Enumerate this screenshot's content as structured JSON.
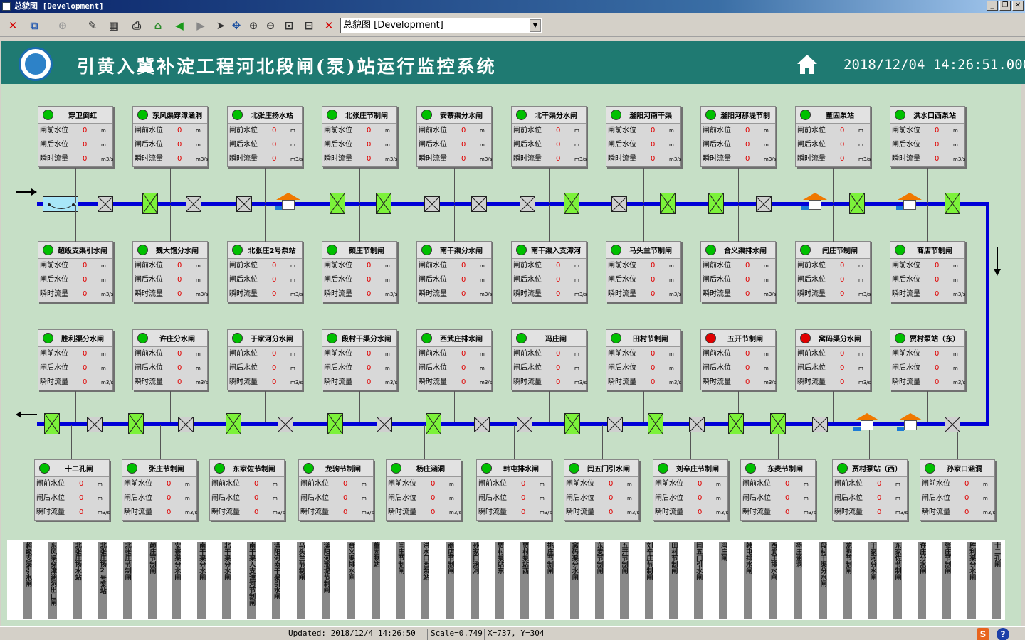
{
  "window": {
    "title": "总貌图 [Development]"
  },
  "toolbar": {
    "view_select": "总貌图 [Development]"
  },
  "header": {
    "title": "引黄入冀补淀工程河北段闸(泵)站运行监控系统",
    "datetime": "2018/12/04 14:26:51.000"
  },
  "row_labels": {
    "front_level": "闸前水位",
    "back_level": "闸后水位",
    "flow": "瞬时流量",
    "unit_level": "m",
    "unit_flow": "m3/s"
  },
  "stations": [
    {
      "name": "穿卫倒虹",
      "status": "green",
      "values": [
        "0",
        "0",
        "0"
      ]
    },
    {
      "name": "东风渠穿漳涵洞",
      "status": "green",
      "values": [
        "0",
        "0",
        "0"
      ]
    },
    {
      "name": "北张庄扬水站",
      "status": "green",
      "values": [
        "0",
        "0",
        "0"
      ]
    },
    {
      "name": "北张庄节制闸",
      "status": "green",
      "values": [
        "0",
        "0",
        "0"
      ]
    },
    {
      "name": "安寨渠分水闸",
      "status": "green",
      "values": [
        "0",
        "0",
        "0"
      ]
    },
    {
      "name": "北干渠分水闸",
      "status": "green",
      "values": [
        "0",
        "0",
        "0"
      ]
    },
    {
      "name": "滏阳河南干渠",
      "status": "green",
      "values": [
        "0",
        "0",
        "0"
      ]
    },
    {
      "name": "滏阳河那堤节制",
      "status": "green",
      "values": [
        "0",
        "0",
        "0"
      ]
    },
    {
      "name": "董固泵站",
      "status": "green",
      "values": [
        "0",
        "0",
        "0"
      ]
    },
    {
      "name": "洪水口西泵站",
      "status": "green",
      "values": [
        "0",
        "0",
        "0"
      ]
    },
    {
      "name": "超级支渠引水闸",
      "status": "green",
      "values": [
        "0",
        "0",
        "0"
      ]
    },
    {
      "name": "魏大馆分水闸",
      "status": "green",
      "values": [
        "0",
        "0",
        "0"
      ]
    },
    {
      "name": "北张庄2号泵站",
      "status": "green",
      "values": [
        "0",
        "0",
        "0"
      ]
    },
    {
      "name": "颜庄节制闸",
      "status": "green",
      "values": [
        "0",
        "0",
        "0"
      ]
    },
    {
      "name": "南干渠分水闸",
      "status": "green",
      "values": [
        "0",
        "0",
        "0"
      ]
    },
    {
      "name": "南干渠入支漳河",
      "status": "green",
      "values": [
        "0",
        "0",
        "0"
      ]
    },
    {
      "name": "马头兰节制闸",
      "status": "green",
      "values": [
        "0",
        "0",
        "0"
      ]
    },
    {
      "name": "合义渠排水闸",
      "status": "green",
      "values": [
        "0",
        "0",
        "0"
      ]
    },
    {
      "name": "闫庄节制闸",
      "status": "green",
      "values": [
        "0",
        "0",
        "0"
      ]
    },
    {
      "name": "商店节制闸",
      "status": "green",
      "values": [
        "0",
        "0",
        "0"
      ]
    },
    {
      "name": "胜利渠分水闸",
      "status": "green",
      "values": [
        "0",
        "0",
        "0"
      ]
    },
    {
      "name": "许庄分水闸",
      "status": "green",
      "values": [
        "0",
        "0",
        "0"
      ]
    },
    {
      "name": "于家河分水闸",
      "status": "green",
      "values": [
        "0",
        "0",
        "0"
      ]
    },
    {
      "name": "段村干渠分水闸",
      "status": "green",
      "values": [
        "0",
        "0",
        "0"
      ]
    },
    {
      "name": "西武庄排水闸",
      "status": "green",
      "values": [
        "0",
        "0",
        "0"
      ]
    },
    {
      "name": "冯庄闸",
      "status": "green",
      "values": [
        "0",
        "0",
        "0"
      ]
    },
    {
      "name": "田村节制闸",
      "status": "green",
      "values": [
        "0",
        "0",
        "0"
      ]
    },
    {
      "name": "五开节制闸",
      "status": "red",
      "values": [
        "0",
        "0",
        "0"
      ]
    },
    {
      "name": "窝码渠分水闸",
      "status": "red",
      "values": [
        "0",
        "0",
        "0"
      ]
    },
    {
      "name": "贾村泵站（东）",
      "status": "green",
      "values": [
        "0",
        "0",
        "0"
      ]
    },
    {
      "name": "十二孔闸",
      "status": "green",
      "values": [
        "0",
        "0",
        "0"
      ]
    },
    {
      "name": "张庄节制闸",
      "status": "green",
      "values": [
        "0",
        "0",
        "0"
      ]
    },
    {
      "name": "东家佐节制闸",
      "status": "green",
      "values": [
        "0",
        "0",
        "0"
      ]
    },
    {
      "name": "龙驹节制闸",
      "status": "green",
      "values": [
        "0",
        "0",
        "0"
      ]
    },
    {
      "name": "杨庄涵洞",
      "status": "green",
      "values": [
        "0",
        "0",
        "0"
      ]
    },
    {
      "name": "韩屯排水闸",
      "status": "green",
      "values": [
        "0",
        "0",
        "0"
      ]
    },
    {
      "name": "闫五门引水闸",
      "status": "green",
      "values": [
        "0",
        "0",
        "0"
      ]
    },
    {
      "name": "刘辛庄节制闸",
      "status": "green",
      "values": [
        "0",
        "0",
        "0"
      ]
    },
    {
      "name": "东麦节制闸",
      "status": "green",
      "values": [
        "0",
        "0",
        "0"
      ]
    },
    {
      "name": "贾村泵站（西）",
      "status": "green",
      "values": [
        "0",
        "0",
        "0"
      ]
    },
    {
      "name": "孙家口涵洞",
      "status": "green",
      "values": [
        "0",
        "0",
        "0"
      ]
    }
  ],
  "bottom_labels": [
    "超级支渠引水闸",
    "东风渠穿漳涵洞出口闸",
    "北张庄扬水站",
    "北张庄扬2号泵站",
    "北张庄节制闸",
    "颜庄节制闸",
    "安寨渠分水闸",
    "南干渠分水闸",
    "北干渠分水闸",
    "南干渠入支漳河节制闸",
    "滏阳河南干渠引水闸",
    "马头兰节制闸",
    "滏阳河那堤节制闸",
    "合义渠排水闸",
    "董固泵站",
    "闫庄节制闸",
    "洪水口西泵站",
    "商店节制闸",
    "孙家口涵洞",
    "贾村泵站东",
    "贾村泵站西",
    "挑庄节制闸",
    "窝码渠分水闸",
    "东麦节制闸",
    "五开节制闸",
    "刘辛庄节制闸",
    "田村节制闸",
    "闫五门引水闸",
    "冯庄闸",
    "韩屯排水闸",
    "西武庄排水闸",
    "杨庄涵洞",
    "段村干渠分水闸",
    "龙驹节制闸",
    "于家河分水闸",
    "东家佐节制闸",
    "许庄分水闸",
    "张庄节制闸",
    "胜利渠分水闸",
    "十二孔闸"
  ],
  "status": {
    "updated": "Updated: 2018/12/4 14:26:50",
    "scale": "Scale=0.749",
    "coords": "X=737, Y=304"
  },
  "colors": {
    "header": "#1f7a72",
    "pipe": "#0000d8",
    "canvas": "#c6dfc6",
    "valve_open": "#7cf23a",
    "valve_closed": "#cfd0cf",
    "alarm": "#e00000"
  }
}
